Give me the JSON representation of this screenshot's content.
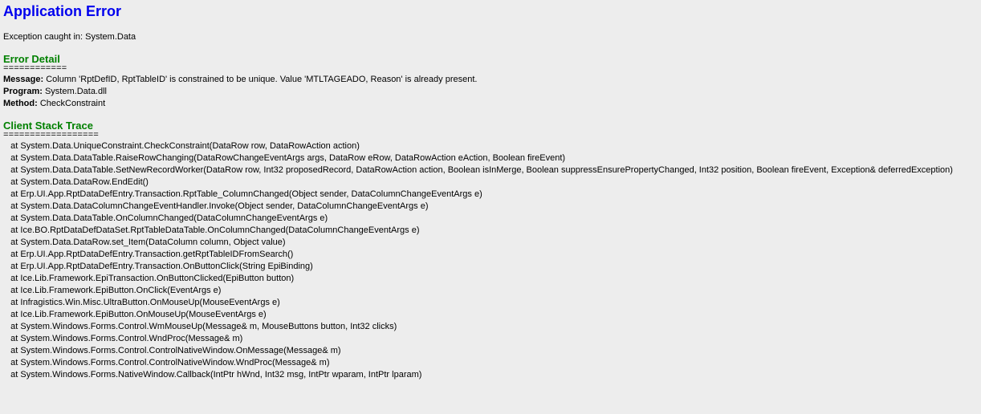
{
  "title": "Application Error",
  "exception": {
    "label": "Exception caught in:",
    "value": "System.Data"
  },
  "error_detail": {
    "header": "Error Detail",
    "separator": "============",
    "message_label": "Message:",
    "message_value": "Column 'RptDefID, RptTableID' is constrained to be unique.  Value 'MTLTAGEADO, Reason' is already present.",
    "program_label": "Program:",
    "program_value": "System.Data.dll",
    "method_label": "Method:",
    "method_value": "CheckConstraint"
  },
  "stack_trace": {
    "header": "Client Stack Trace",
    "separator": "==================",
    "lines": [
      "   at System.Data.UniqueConstraint.CheckConstraint(DataRow row, DataRowAction action)",
      "   at System.Data.DataTable.RaiseRowChanging(DataRowChangeEventArgs args, DataRow eRow, DataRowAction eAction, Boolean fireEvent)",
      "   at System.Data.DataTable.SetNewRecordWorker(DataRow row, Int32 proposedRecord, DataRowAction action, Boolean isInMerge, Boolean suppressEnsurePropertyChanged, Int32 position, Boolean fireEvent, Exception& deferredException)",
      "   at System.Data.DataRow.EndEdit()",
      "   at Erp.UI.App.RptDataDefEntry.Transaction.RptTable_ColumnChanged(Object sender, DataColumnChangeEventArgs e)",
      "   at System.Data.DataColumnChangeEventHandler.Invoke(Object sender, DataColumnChangeEventArgs e)",
      "   at System.Data.DataTable.OnColumnChanged(DataColumnChangeEventArgs e)",
      "   at Ice.BO.RptDataDefDataSet.RptTableDataTable.OnColumnChanged(DataColumnChangeEventArgs e)",
      "   at System.Data.DataRow.set_Item(DataColumn column, Object value)",
      "   at Erp.UI.App.RptDataDefEntry.Transaction.getRptTableIDFromSearch()",
      "   at Erp.UI.App.RptDataDefEntry.Transaction.OnButtonClick(String EpiBinding)",
      "   at Ice.Lib.Framework.EpiTransaction.OnButtonClicked(EpiButton button)",
      "   at Ice.Lib.Framework.EpiButton.OnClick(EventArgs e)",
      "   at Infragistics.Win.Misc.UltraButton.OnMouseUp(MouseEventArgs e)",
      "   at Ice.Lib.Framework.EpiButton.OnMouseUp(MouseEventArgs e)",
      "   at System.Windows.Forms.Control.WmMouseUp(Message& m, MouseButtons button, Int32 clicks)",
      "   at System.Windows.Forms.Control.WndProc(Message& m)",
      "   at System.Windows.Forms.Control.ControlNativeWindow.OnMessage(Message& m)",
      "   at System.Windows.Forms.Control.ControlNativeWindow.WndProc(Message& m)",
      "   at System.Windows.Forms.NativeWindow.Callback(IntPtr hWnd, Int32 msg, IntPtr wparam, IntPtr lparam)"
    ]
  }
}
